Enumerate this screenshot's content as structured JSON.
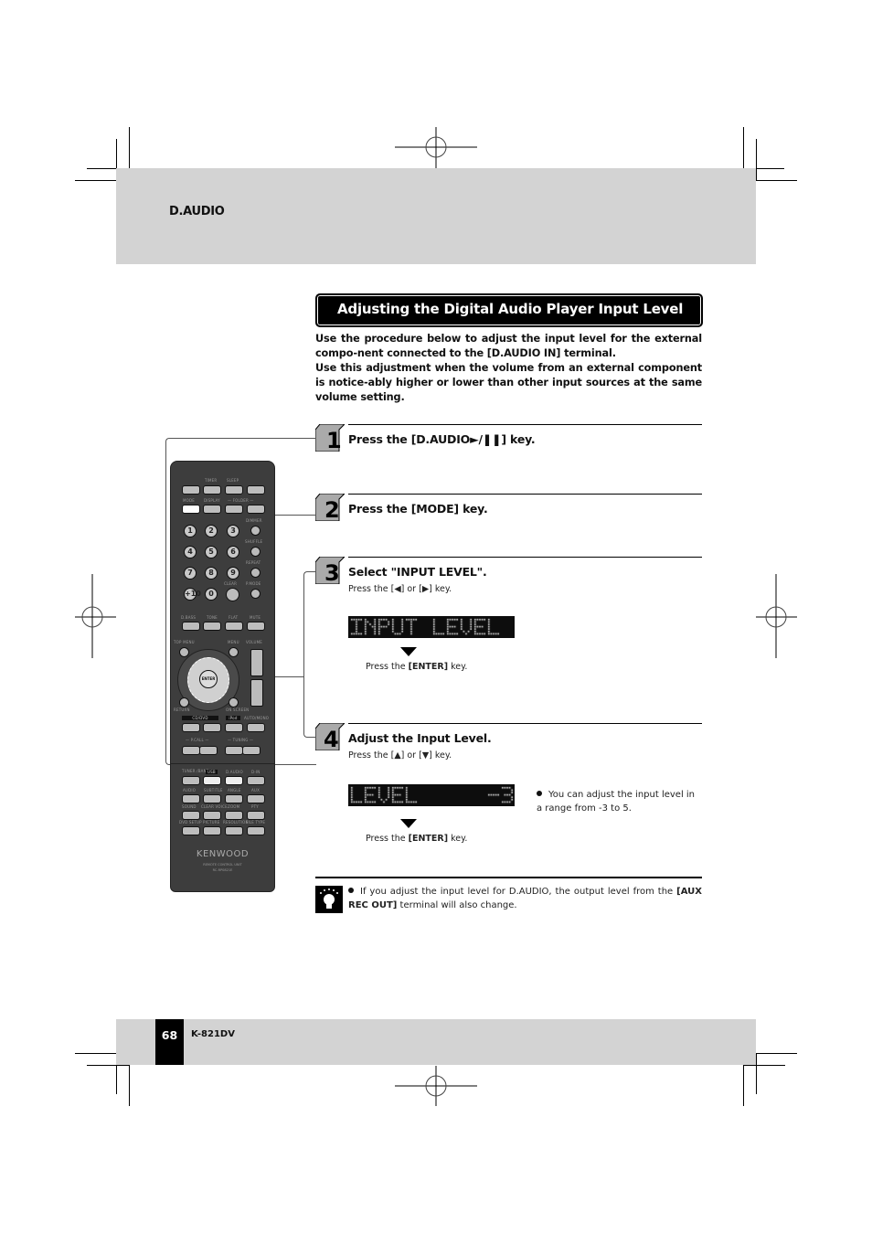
{
  "header": {
    "section": "D.AUDIO"
  },
  "title": "Adjusting the Digital Audio Player Input Level",
  "intro": {
    "p1_a": "Use the procedure below to adjust the input level for the external compo-nent connected to the ",
    "p1_b": "[D.AUDIO IN]",
    "p1_c": " terminal.",
    "p2": "Use this adjustment when the volume from an external component is notice-ably higher or lower than other input sources at the same volume setting."
  },
  "steps": [
    {
      "num": "1",
      "title": "Press the [D.AUDIO►/❚❚] key."
    },
    {
      "num": "2",
      "title": "Press the [MODE] key."
    },
    {
      "num": "3",
      "title": "Select \"INPUT LEVEL\".",
      "sub": "Press the [◀] or [▶] key.",
      "display": "INPUT LEVEL ",
      "enter_a": "Press the ",
      "enter_b": "[ENTER]",
      "enter_c": " key."
    },
    {
      "num": "4",
      "title": "Adjust the Input Level.",
      "sub": "Press the [▲] or [▼] key.",
      "display": "LEVEL     -3",
      "enter_a": "Press the ",
      "enter_b": "[ENTER]",
      "enter_c": " key.",
      "note": "You can adjust the input level in a range from -3 to 5."
    }
  ],
  "tip": {
    "a": "If you adjust the input level for D.AUDIO, the output level from the ",
    "b": "[AUX REC OUT]",
    "c": " terminal will also change."
  },
  "remote": {
    "brand": "KENWOOD",
    "caption": "REMOTE CONTROL UNIT",
    "model": "RC-RP0821E",
    "labels": {
      "timer": "TIMER",
      "sleep": "SLEEP",
      "mode": "MODE",
      "display": "DISPLAY",
      "folder": "— FOLDER —",
      "dimmer": "DIMMER",
      "shuffle": "SHUFFLE",
      "repeat": "REPEAT",
      "clear": "CLEAR",
      "pmode": "P.MODE",
      "dbass": "D.BASS",
      "tone": "TONE",
      "flat": "FLAT",
      "mute": "MUTE",
      "topmenu": "TOP MENU",
      "menu": "MENU",
      "volume": "VOLUME",
      "enter": "ENTER",
      "return": "RETURN",
      "onscreen": "ON SCREEN",
      "cddvd": "CD/DVD",
      "ipod": "iPod",
      "automono": "AUTO/MONO",
      "pcall": "— P.CALL —",
      "tuning": "— TUNING —",
      "tuner": "TUNER /BAND",
      "usb": "USB",
      "daudio": "D.AUDIO",
      "din": "D-IN",
      "audio": "AUDIO",
      "subtitle": "SUBTITLE",
      "angle": "ANGLE",
      "aux": "AUX",
      "sound": "SOUND",
      "clearvoice": "CLEAR VOICE",
      "zoom": "ZOOM",
      "pty": "PTY",
      "dvdsetup": "DVD SETUP",
      "picture": "PICTURE",
      "resolution": "RESOLUTION",
      "filetype": "FILE TYPE"
    },
    "digits": [
      "1",
      "2",
      "3",
      "4",
      "5",
      "6",
      "7",
      "8",
      "9",
      "+10",
      "0"
    ]
  },
  "footer": {
    "page": "68",
    "model": "K-821DV"
  }
}
